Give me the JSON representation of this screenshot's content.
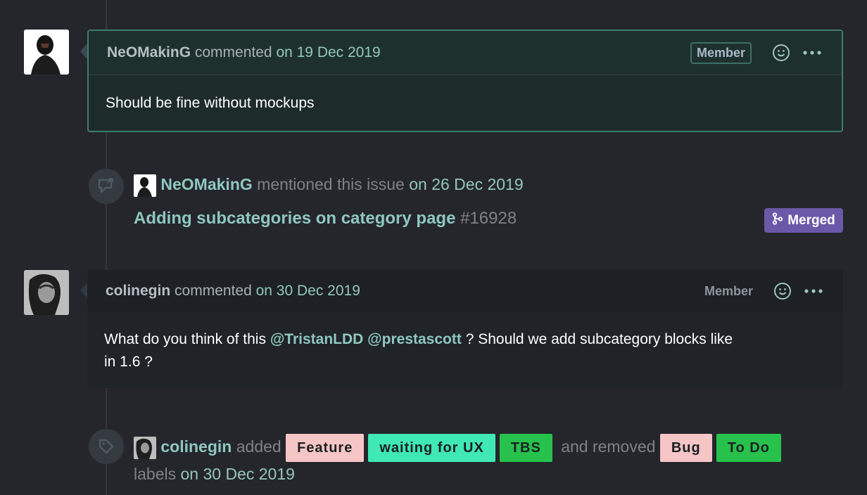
{
  "comments": [
    {
      "author": "NeOMakinG",
      "action": "commented",
      "date": "on 19 Dec 2019",
      "badge": "Member",
      "body": "Should be fine without mockups"
    },
    {
      "author": "colinegin",
      "action": "commented",
      "date": "on 30 Dec 2019",
      "badge": "Member",
      "body_before": "What do you think of this",
      "mention1": "@TristanLDD",
      "mention2": "@prestascott",
      "body_after": "? Should we add subcategory blocks like",
      "body_line2": "in 1.6 ?"
    }
  ],
  "mention_event": {
    "author": "NeOMakinG",
    "action": "mentioned this issue",
    "date": "on 26 Dec 2019",
    "ref_title": "Adding subcategories on category page",
    "ref_number": "#16928",
    "ref_status": "Merged"
  },
  "label_event": {
    "author": "colinegin",
    "added_word": "added",
    "removed_word": "and removed",
    "labels_word": "labels",
    "date": "on 30 Dec 2019",
    "added_labels": [
      {
        "name": "Feature",
        "color": "#f6c6c6"
      },
      {
        "name": "waiting for UX",
        "color": "#3fe8b4"
      },
      {
        "name": "TBS",
        "color": "#27c24c"
      }
    ],
    "removed_labels": [
      {
        "name": "Bug",
        "color": "#f6c6c6"
      },
      {
        "name": "To Do",
        "color": "#27c24c"
      }
    ]
  },
  "icons": [
    "smiley-icon",
    "more-icon",
    "cross-reference-icon",
    "tag-icon",
    "merge-icon"
  ]
}
